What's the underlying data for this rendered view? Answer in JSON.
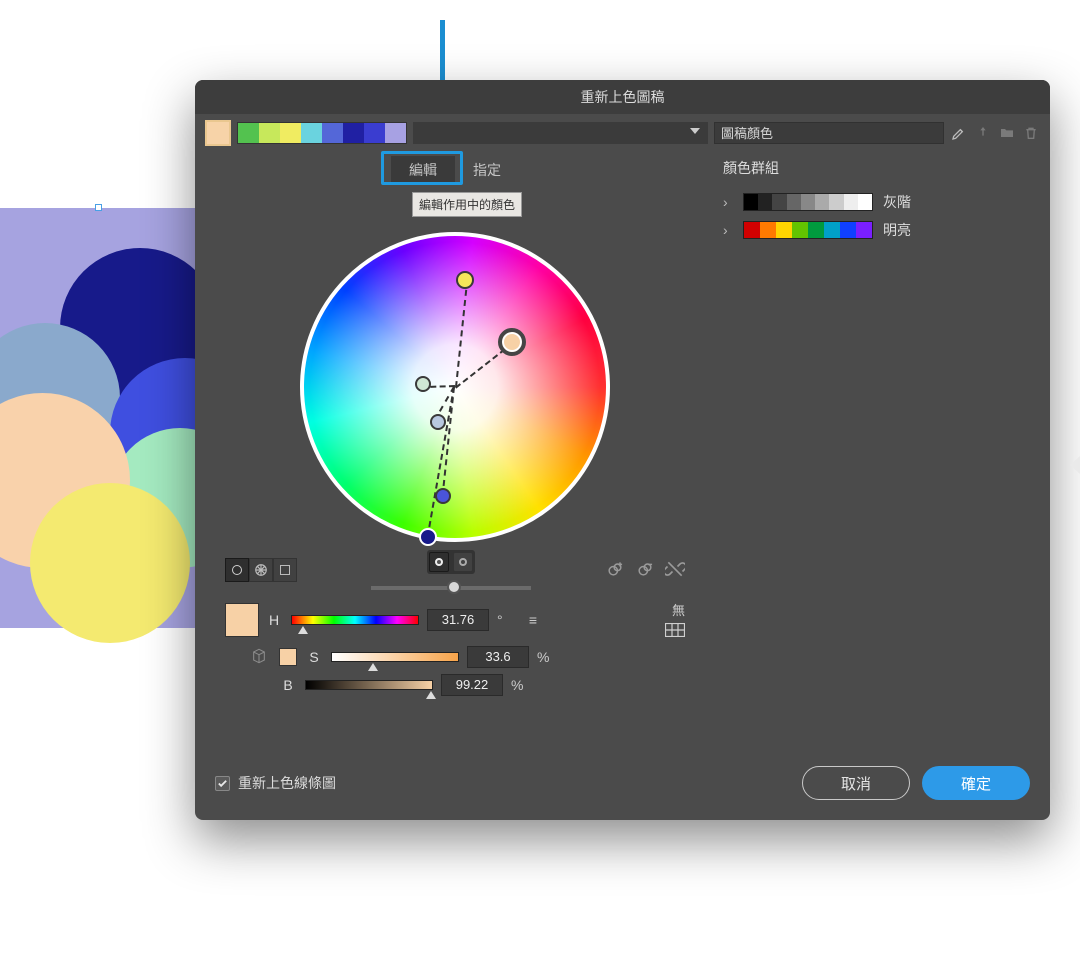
{
  "dialog": {
    "title": "重新上色圖稿",
    "preset_field_placeholder": "",
    "artwork_colors_value": "圖稿顏色",
    "tabs": {
      "edit": "編輯",
      "assign": "指定"
    },
    "tooltip_edit_active": "編輯作用中的顏色"
  },
  "color_groups": {
    "title": "顏色群組",
    "items": [
      {
        "label": "灰階"
      },
      {
        "label": "明亮"
      }
    ]
  },
  "hsb": {
    "h": {
      "label": "H",
      "value": "31.76",
      "unit": "°"
    },
    "s": {
      "label": "S",
      "value": "33.6",
      "unit": "%"
    },
    "b": {
      "label": "B",
      "value": "99.22",
      "unit": "%"
    },
    "none_label": "無"
  },
  "footer": {
    "recolor_lineart": "重新上色線條圖",
    "cancel": "取消",
    "ok": "確定"
  }
}
